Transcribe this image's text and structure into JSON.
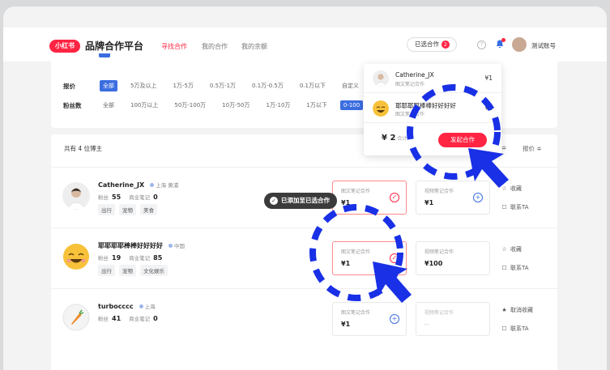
{
  "app": {
    "logo_text": "小红书",
    "brand_title": "品牌合作平台"
  },
  "nav": {
    "tabs": [
      {
        "label": "寻找合作",
        "active": true
      },
      {
        "label": "我的合作",
        "active": false
      },
      {
        "label": "我的余额",
        "active": false
      }
    ],
    "selected_label": "已选合作",
    "selected_count": "2",
    "help_glyph": "?",
    "account_name": "测试账号"
  },
  "filters": {
    "price": {
      "label": "报价",
      "options": [
        "全部",
        "5万及以上",
        "1万-5万",
        "0.5万-1万",
        "0.1万-0.5万",
        "0.1万以下",
        "自定义"
      ],
      "active_index": 0
    },
    "fans": {
      "label": "粉丝数",
      "options": [
        "全部",
        "100万以上",
        "50万-100万",
        "10万-50万",
        "1万-10万",
        "1万以下",
        "0-100"
      ],
      "active_index": 6
    }
  },
  "list": {
    "count_text": "共有 4 位博主",
    "sort_label_a": "≑",
    "sort_label_b": "报价 ≑",
    "creators": [
      {
        "name": "Catherine_JX",
        "location": "上海 黄浦",
        "fans_label": "粉丝",
        "fans": "55",
        "notes_label": "商业笔记",
        "notes": "0",
        "tags": [
          "出行",
          "宠物",
          "美食"
        ],
        "note_collab": {
          "title": "图文笔记合作",
          "price": "¥1",
          "selected": true
        },
        "video_collab": {
          "title": "视频笔记合作",
          "price": "¥1",
          "selected": false
        },
        "fav_label": "收藏",
        "contact_label": "联系TA"
      },
      {
        "name": "耶耶耶耶棒棒好好好好",
        "location": "中国",
        "fans_label": "粉丝",
        "fans": "19",
        "notes_label": "商业笔记",
        "notes": "85",
        "tags": [
          "出行",
          "宠物",
          "文化娱乐"
        ],
        "note_collab": {
          "title": "图文笔记合作",
          "price": "¥1",
          "selected": true
        },
        "video_collab": {
          "title": "视频笔记合作",
          "price": "¥100",
          "selected": false
        },
        "fav_label": "收藏",
        "contact_label": "联系TA"
      },
      {
        "name": "turbocccc",
        "location": "上海",
        "fans_label": "粉丝",
        "fans": "41",
        "notes_label": "商业笔记",
        "notes": "0",
        "tags": [],
        "note_collab": {
          "title": "图文笔记合作",
          "price": "¥1",
          "selected": false
        },
        "video_collab": {
          "title": "视频笔记合作",
          "price": "--",
          "selected": false
        },
        "fav_label": "取消收藏",
        "contact_label": "联系TA"
      }
    ]
  },
  "toast": {
    "text": "已添加至已选合作"
  },
  "dropdown": {
    "items": [
      {
        "name": "Catherine_JX",
        "sub": "图文笔记合作",
        "price": "¥1"
      },
      {
        "name": "耶耶耶耶棒棒好好好好",
        "sub": "图文笔记合作",
        "price": "¥1"
      }
    ],
    "total": "¥ 2",
    "total_label": "合计",
    "cta_label": "发起合作"
  },
  "colors": {
    "brand_red": "#ff2442",
    "accent_blue": "#3a6de0",
    "annotation_blue": "#1930e6"
  },
  "icons": {
    "check": "✓",
    "plus": "+",
    "star_empty": "☆",
    "star_filled": "★",
    "chat": "☐",
    "bell": "🔔"
  }
}
